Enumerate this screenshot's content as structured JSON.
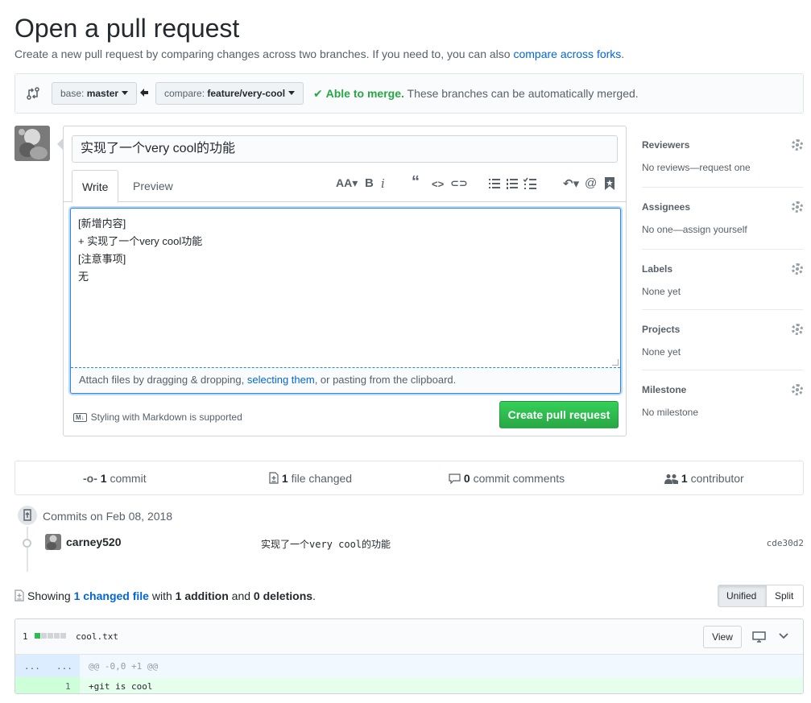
{
  "header": {
    "title": "Open a pull request",
    "subtitle_prefix": "Create a new pull request by comparing changes across two branches. If you need to, you can also ",
    "subtitle_link": "compare across forks",
    "subtitle_suffix": "."
  },
  "range": {
    "base_prefix": "base: ",
    "base_branch": "master",
    "compare_prefix": "compare: ",
    "compare_branch": "feature/very-cool",
    "merge_status": "Able to merge.",
    "merge_detail": " These branches can be automatically merged."
  },
  "form": {
    "title_value": "实现了一个very cool的功能",
    "tabs": [
      "Write",
      "Preview"
    ],
    "body_lines": [
      "[新增内容]",
      "+ 实现了一个very cool功能",
      "[注意事项]",
      "无"
    ],
    "attach_prefix": "Attach files by dragging & dropping, ",
    "attach_link": "selecting them",
    "attach_suffix": ", or pasting from the clipboard.",
    "markdown_badge": "M↓",
    "markdown_note": "Styling with Markdown is supported",
    "submit_label": "Create pull request"
  },
  "sidebar": [
    {
      "heading": "Reviewers",
      "value": "No reviews—request one"
    },
    {
      "heading": "Assignees",
      "value": "No one—assign yourself"
    },
    {
      "heading": "Labels",
      "value": "None yet"
    },
    {
      "heading": "Projects",
      "value": "None yet"
    },
    {
      "heading": "Milestone",
      "value": "No milestone"
    }
  ],
  "numbers": {
    "commits_count": "1",
    "commits_label": " commit",
    "files_count": "1",
    "files_label": " file changed",
    "comments_count": "0",
    "comments_label": " commit comments",
    "contributors_count": "1",
    "contributors_label": " contributor"
  },
  "commits": {
    "date_label": "Commits on Feb 08, 2018",
    "items": [
      {
        "author": "carney520",
        "message": "实现了一个very cool的功能",
        "sha": "cde30d2"
      }
    ]
  },
  "toc": {
    "prefix": "Showing ",
    "link": "1 changed file",
    "mid": " with ",
    "additions": "1 addition",
    "and": " and ",
    "deletions": "0 deletions",
    "suffix": ".",
    "unified_label": "Unified",
    "split_label": "Split"
  },
  "file": {
    "stat_count": "1",
    "name": "cool.txt",
    "view_label": "View",
    "hunk_num_left": "...",
    "hunk_num_right": "...",
    "hunk_header": "@@ -0,0 +1 @@",
    "line_num": "1",
    "line_content": "+git is cool"
  },
  "colors": {
    "accent": "#0366d6",
    "success": "#28a745",
    "addition_bg": "#e6ffed",
    "hunk_bg": "#f1f8ff"
  }
}
